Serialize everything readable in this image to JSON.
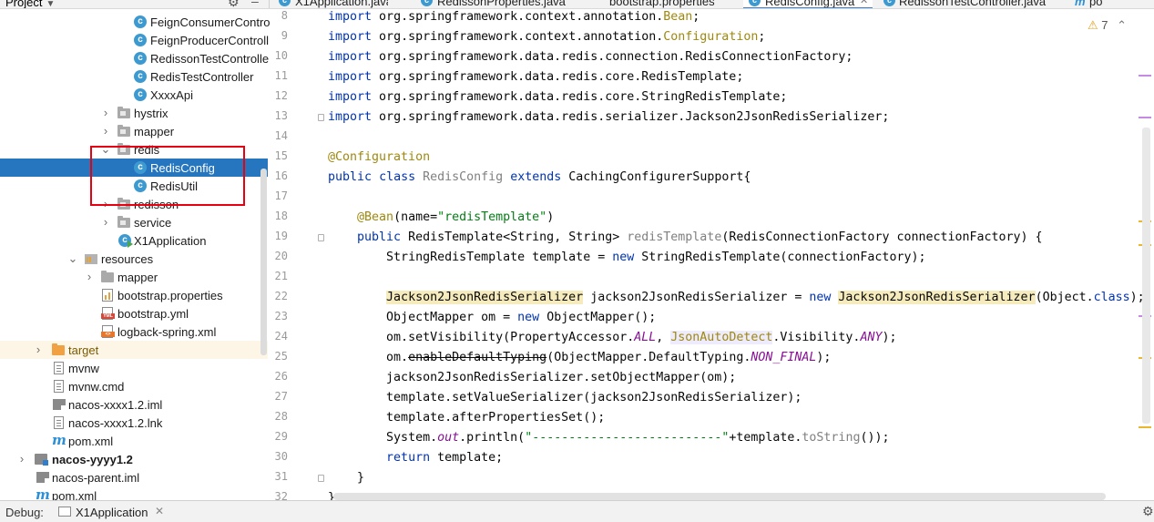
{
  "project_header": {
    "title": "Project",
    "dropdown_glyph": "▼",
    "settings_icon": "gear-icon",
    "collapse_icon": "minus-icon"
  },
  "editor_tabs": [
    {
      "label": "X1Application.java",
      "icon": "class-icon",
      "active": false
    },
    {
      "label": "RedissonProperties.java",
      "icon": "class-icon",
      "active": false
    },
    {
      "label": "bootstrap.properties",
      "icon": "properties-file-icon",
      "active": false
    },
    {
      "label": "RedisConfig.java",
      "icon": "class-icon",
      "active": true
    },
    {
      "label": "RedissonTestController.java",
      "icon": "class-icon",
      "active": false
    },
    {
      "label": "po",
      "icon": "maven-icon",
      "active": false
    }
  ],
  "tree": [
    {
      "label": "FeignConsumerContro",
      "icon": "class"
    },
    {
      "label": "FeignProducerControll",
      "icon": "class"
    },
    {
      "label": "RedissonTestControlle",
      "icon": "class"
    },
    {
      "label": "RedisTestController",
      "icon": "class"
    },
    {
      "label": "XxxxApi",
      "icon": "class"
    },
    {
      "label": "hystrix",
      "icon": "package"
    },
    {
      "label": "mapper",
      "icon": "package"
    },
    {
      "label": "redis",
      "icon": "package"
    },
    {
      "label": "RedisConfig",
      "icon": "class"
    },
    {
      "label": "RedisUtil",
      "icon": "class"
    },
    {
      "label": "redisson",
      "icon": "package"
    },
    {
      "label": "service",
      "icon": "package"
    },
    {
      "label": "X1Application",
      "icon": "run-class"
    },
    {
      "label": "resources",
      "icon": "resources"
    },
    {
      "label": "mapper",
      "icon": "folder"
    },
    {
      "label": "bootstrap.properties",
      "icon": "properties"
    },
    {
      "label": "bootstrap.yml",
      "icon": "yml"
    },
    {
      "label": "logback-spring.xml",
      "icon": "xml"
    },
    {
      "label": "target",
      "icon": "folder-excluded"
    },
    {
      "label": "mvnw",
      "icon": "file"
    },
    {
      "label": "mvnw.cmd",
      "icon": "file"
    },
    {
      "label": "nacos-xxxx1.2.iml",
      "icon": "iml"
    },
    {
      "label": "nacos-xxxx1.2.lnk",
      "icon": "file"
    },
    {
      "label": "pom.xml",
      "icon": "maven"
    },
    {
      "label": "nacos-yyyy1.2",
      "icon": "module"
    },
    {
      "label": "nacos-parent.iml",
      "icon": "iml"
    },
    {
      "label": "pom.xml",
      "icon": "maven"
    }
  ],
  "code": {
    "line_numbers": [
      "8",
      "9",
      "10",
      "11",
      "12",
      "13",
      "14",
      "15",
      "16",
      "17",
      "18",
      "19",
      "20",
      "21",
      "22",
      "23",
      "24",
      "25",
      "26",
      "27",
      "28",
      "29",
      "30",
      "31",
      "32"
    ],
    "l8": {
      "kw": "import",
      "rest": " org.springframework.context.annotation.",
      "ann": "Bean",
      "end": ";"
    },
    "l9": {
      "kw": "import",
      "rest": " org.springframework.context.annotation.",
      "ann": "Configuration",
      "end": ";"
    },
    "l10": {
      "kw": "import",
      "rest": " org.springframework.data.redis.connection.RedisConnectionFactory;"
    },
    "l11": {
      "kw": "import",
      "rest": " org.springframework.data.redis.core.RedisTemplate;"
    },
    "l12": {
      "kw": "import",
      "rest": " org.springframework.data.redis.core.StringRedisTemplate;"
    },
    "l13": {
      "kw": "import",
      "rest": " org.springframework.data.redis.serializer.Jackson2JsonRedisSerializer;"
    },
    "l15": {
      "ann": "@Configuration"
    },
    "l16": {
      "kw1": "public",
      "kw2": "class",
      "cls": "RedisConfig",
      "kw3": "extends",
      "rest": " CachingConfigurerSupport{"
    },
    "l18": {
      "ann": "@Bean",
      "p1": "(name=",
      "str": "\"redisTemplate\"",
      "p2": ")"
    },
    "l19": {
      "kw": "public",
      "t": " RedisTemplate<String, String> ",
      "m": "redisTemplate",
      "rest": "(RedisConnectionFactory connectionFactory) {"
    },
    "l20": {
      "a": "StringRedisTemplate template = ",
      "kw": "new",
      "b": " StringRedisTemplate(connectionFactory);"
    },
    "l22": {
      "h1": "Jackson2JsonRedisSerializer",
      "a": " jackson2JsonRedisSerializer = ",
      "kw": "new",
      "h2": "Jackson2JsonRedisSerializer",
      "b": "(Object.",
      "kw2": "class",
      "c": ");"
    },
    "l23": {
      "a": "ObjectMapper om = ",
      "kw": "new",
      "b": " ObjectMapper();"
    },
    "l24": {
      "a": "om.setVisibility(PropertyAccessor.",
      "f1": "ALL",
      "b": ", ",
      "h": "JsonAutoDetect",
      "c": ".Visibility.",
      "f2": "ANY",
      "d": ");"
    },
    "l25": {
      "a": "om.",
      "s": "enableDefaultTyping",
      "b": "(ObjectMapper.DefaultTyping.",
      "f": "NON_FINAL",
      "c": ");"
    },
    "l26": {
      "a": "jackson2JsonRedisSerializer.setObjectMapper(om);"
    },
    "l27": {
      "a": "template.setValueSerializer(jackson2JsonRedisSerializer);"
    },
    "l28": {
      "a": "template.afterPropertiesSet();"
    },
    "l29": {
      "a": "System.",
      "f": "out",
      "b": ".println(",
      "str": "\"--------------------------\"",
      "c": "+template.",
      "m": "toString",
      "d": "());"
    },
    "l30": {
      "kw": "return",
      "a": " template;"
    },
    "l31": {
      "a": "}"
    },
    "l32": {
      "a": "}"
    }
  },
  "inspections": {
    "warning_count": "7",
    "warning_glyph": "⚠",
    "nav_up": "⌃"
  },
  "debug_bar": {
    "label": "Debug:",
    "session": "X1Application",
    "close": "✕",
    "settings_icon": "gear-icon"
  },
  "colors": {
    "selection": "#2675bf",
    "highlight_box": "#e60012",
    "keyword": "#0033b3",
    "annotation": "#9e880d",
    "string": "#067d17"
  }
}
